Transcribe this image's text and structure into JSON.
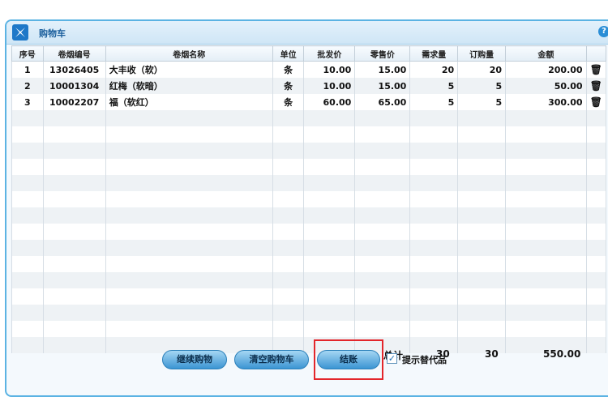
{
  "window": {
    "title": "购物车"
  },
  "table": {
    "headers": [
      "序号",
      "卷烟编号",
      "卷烟名称",
      "单位",
      "批发价",
      "零售价",
      "需求量",
      "订购量",
      "金额",
      ""
    ],
    "rows": [
      [
        "1",
        "13026405",
        "大丰收（软）",
        "条",
        "10.00",
        "15.00",
        "20",
        "20",
        "200.00"
      ],
      [
        "2",
        "10001304",
        "红梅（软暗）",
        "条",
        "10.00",
        "15.00",
        "5",
        "5",
        "50.00"
      ],
      [
        "3",
        "10002207",
        "福（软红）",
        "条",
        "60.00",
        "65.00",
        "5",
        "5",
        "300.00"
      ]
    ]
  },
  "summary": {
    "label": "总计",
    "demand_total": "30",
    "order_total": "30",
    "amount_total": "550.00"
  },
  "buttons": {
    "continue": "继续购物",
    "clear": "清空购物车",
    "checkout": "结账"
  },
  "checkbox": {
    "label": "提示替代品",
    "checked": true
  }
}
